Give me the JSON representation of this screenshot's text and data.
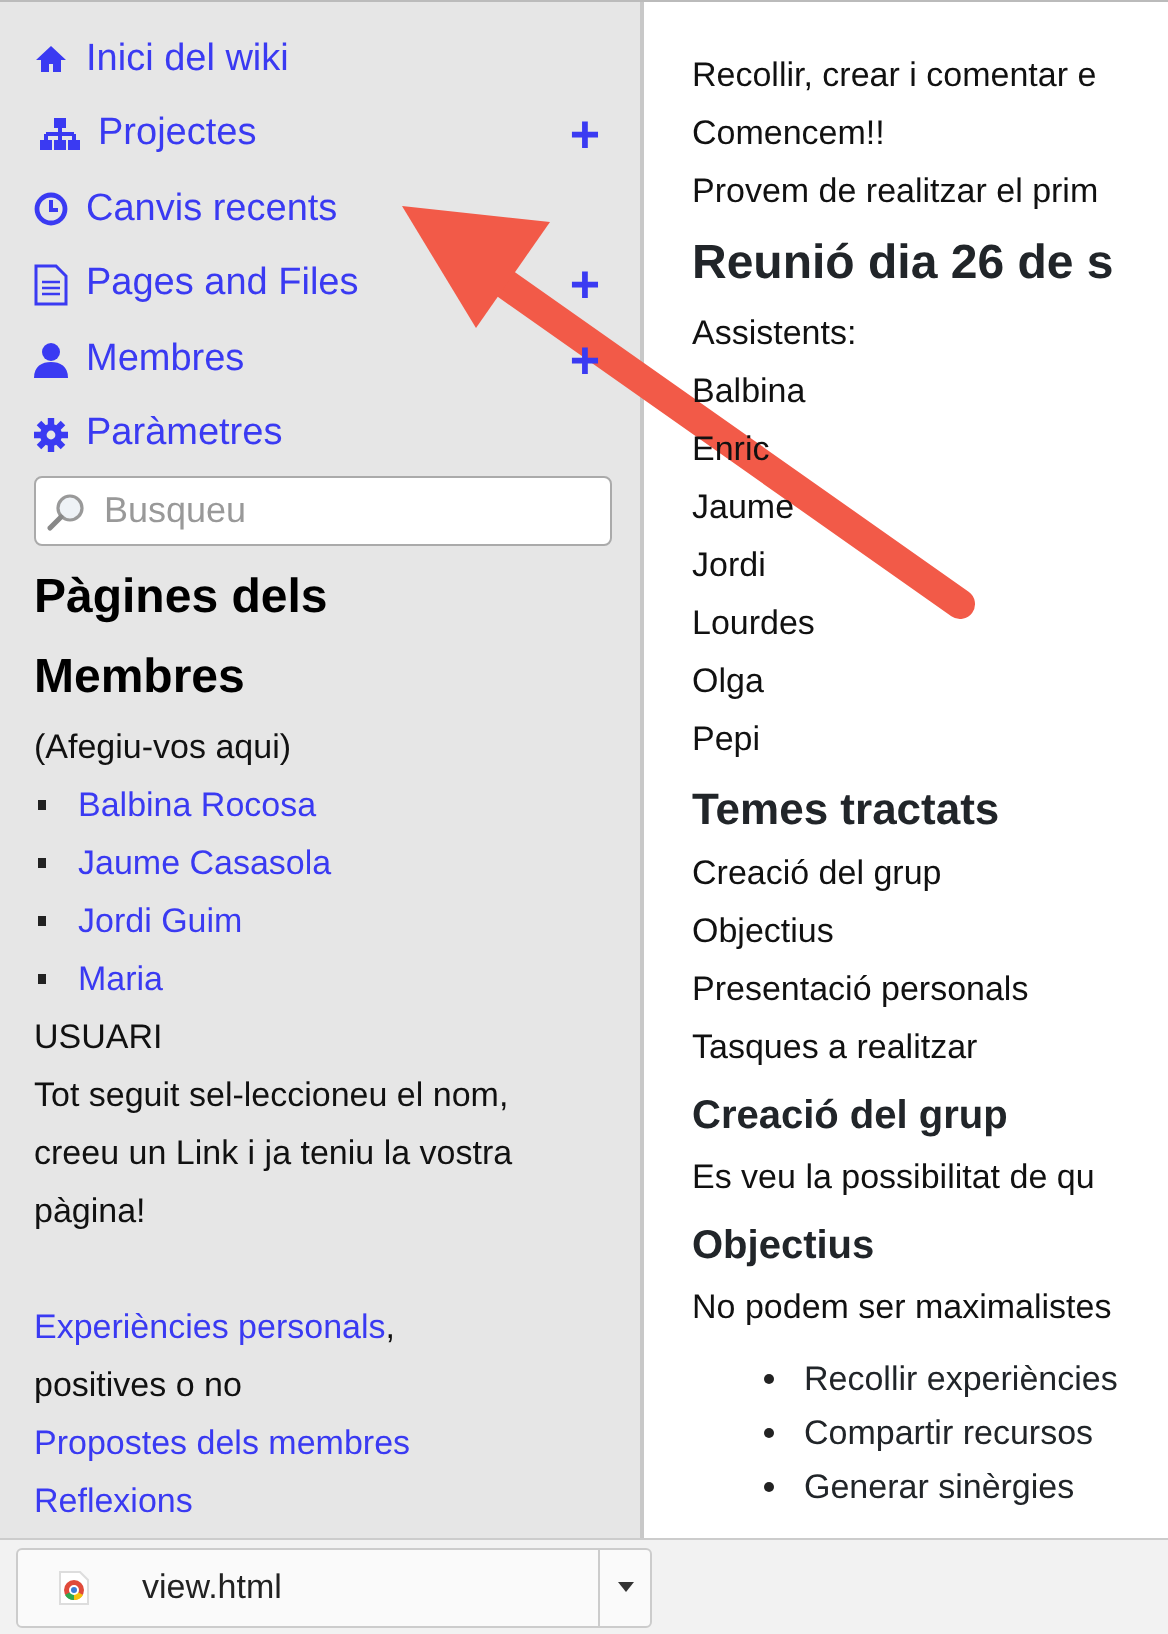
{
  "sidebar": {
    "nav": [
      {
        "label": "Inici del wiki"
      },
      {
        "label": "Projectes",
        "add": "+"
      },
      {
        "label": "Canvis recents"
      },
      {
        "label": "Pages and Files",
        "add": "+"
      },
      {
        "label": "Membres",
        "add": "+"
      },
      {
        "label": "Paràmetres"
      }
    ],
    "search": {
      "placeholder": "Busqueu"
    },
    "members_heading": "Pàgines dels Membres",
    "members_note": "(Afegiu-vos aqui)",
    "members": [
      "Balbina Rocosa",
      "Jaume Casasola",
      "Jordi Guim",
      "Maria"
    ],
    "user_label": "USUARI",
    "instructions": "Tot seguit sel-leccioneu el nom, creeu un Link i ja teniu la vostra pàgina!",
    "links": [
      {
        "kind": "link_with_text",
        "link": "Experiències personals",
        "text": ", positives o no"
      },
      {
        "kind": "link",
        "link": "Propostes dels membres"
      },
      {
        "kind": "link",
        "link": "Reflexions"
      }
    ]
  },
  "content": [
    {
      "kind": "p",
      "text": "Recollir, crear i comentar e"
    },
    {
      "kind": "p",
      "text": "Comencem!!"
    },
    {
      "kind": "p",
      "text": "Provem de realitzar el prim"
    },
    {
      "kind": "h2",
      "text": "Reunió dia 26 de s"
    },
    {
      "kind": "p",
      "text": "Assistents:"
    },
    {
      "kind": "p",
      "text": "Balbina"
    },
    {
      "kind": "p",
      "text": "Enric"
    },
    {
      "kind": "p",
      "text": "Jaume"
    },
    {
      "kind": "p",
      "text": "Jordi"
    },
    {
      "kind": "p",
      "text": "Lourdes"
    },
    {
      "kind": "p",
      "text": "Olga"
    },
    {
      "kind": "p",
      "text": "Pepi"
    },
    {
      "kind": "h3",
      "text": "Temes tractats"
    },
    {
      "kind": "p",
      "text": "Creació del grup"
    },
    {
      "kind": "p",
      "text": "Objectius"
    },
    {
      "kind": "p",
      "text": "Presentació personals"
    },
    {
      "kind": "p",
      "text": "Tasques a realitzar"
    },
    {
      "kind": "h4",
      "text": "Creació del grup"
    },
    {
      "kind": "p",
      "text": "Es veu la possibilitat de qu"
    },
    {
      "kind": "h4",
      "text": "Objectius"
    },
    {
      "kind": "p",
      "text": "No podem ser maximalistes"
    },
    {
      "kind": "li",
      "text": "Recollir experiències"
    },
    {
      "kind": "li",
      "text": "Compartir recursos"
    },
    {
      "kind": "li",
      "text": "Generar sinèrgies"
    }
  ],
  "download_bar": {
    "file": "view.html"
  }
}
